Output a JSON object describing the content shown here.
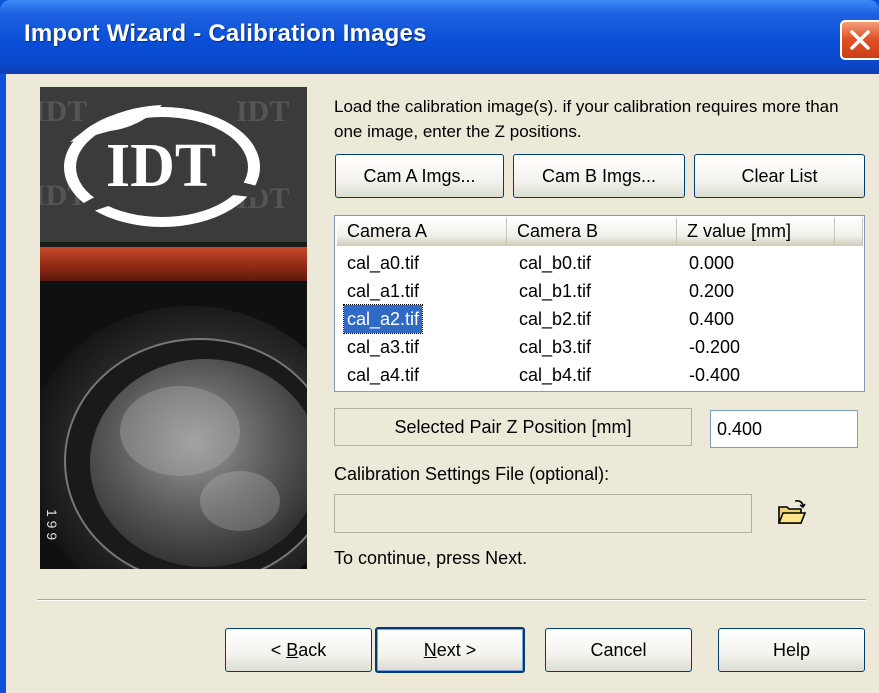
{
  "window": {
    "title": "Import Wizard - Calibration Images"
  },
  "sidebar": {
    "logo_text": "IDT",
    "pattern_text": "IDT",
    "lens_markings": "1 9 9"
  },
  "instructions": "Load the calibration image(s). if your calibration requires more than one image, enter the Z positions.",
  "buttons": {
    "cam_a": "Cam A Imgs...",
    "cam_b": "Cam B Imgs...",
    "clear": "Clear List"
  },
  "table": {
    "columns": [
      "Camera A",
      "Camera B",
      "Z value [mm]"
    ],
    "rows": [
      {
        "camera_a": "cal_a0.tif",
        "camera_b": "cal_b0.tif",
        "z": "0.000"
      },
      {
        "camera_a": "cal_a1.tif",
        "camera_b": "cal_b1.tif",
        "z": "0.200"
      },
      {
        "camera_a": "cal_a2.tif",
        "camera_b": "cal_b2.tif",
        "z": "0.400"
      },
      {
        "camera_a": "cal_a3.tif",
        "camera_b": "cal_b3.tif",
        "z": "-0.200"
      },
      {
        "camera_a": "cal_a4.tif",
        "camera_b": "cal_b4.tif",
        "z": "-0.400"
      }
    ],
    "selected_row": 2
  },
  "z_position": {
    "label": "Selected Pair Z Position [mm]",
    "value": "0.400"
  },
  "settings_file": {
    "label": "Calibration Settings File (optional):",
    "value": "",
    "browse_icon": "open-folder-icon"
  },
  "continue_text": "To continue, press Next.",
  "nav": {
    "back_prefix": "< ",
    "back_key": "B",
    "back_rest": "ack",
    "next_key": "N",
    "next_rest": "ext >",
    "cancel": "Cancel",
    "help": "Help"
  },
  "colors": {
    "title_bar": "#0a4fd8",
    "client_bg": "#ece9d8",
    "selection": "#316ac5",
    "close_button": "#e1532a",
    "button_border": "#003c74"
  }
}
